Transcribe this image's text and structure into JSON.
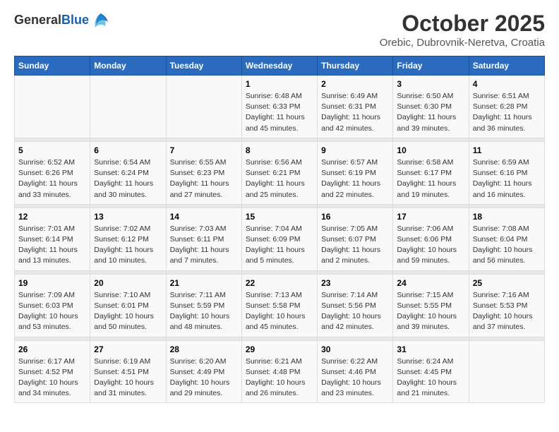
{
  "header": {
    "logo_general": "General",
    "logo_blue": "Blue",
    "title": "October 2025",
    "subtitle": "Orebic, Dubrovnik-Neretva, Croatia"
  },
  "days_of_week": [
    "Sunday",
    "Monday",
    "Tuesday",
    "Wednesday",
    "Thursday",
    "Friday",
    "Saturday"
  ],
  "weeks": [
    {
      "days": [
        {
          "num": "",
          "detail": ""
        },
        {
          "num": "",
          "detail": ""
        },
        {
          "num": "",
          "detail": ""
        },
        {
          "num": "1",
          "detail": "Sunrise: 6:48 AM\nSunset: 6:33 PM\nDaylight: 11 hours and 45 minutes."
        },
        {
          "num": "2",
          "detail": "Sunrise: 6:49 AM\nSunset: 6:31 PM\nDaylight: 11 hours and 42 minutes."
        },
        {
          "num": "3",
          "detail": "Sunrise: 6:50 AM\nSunset: 6:30 PM\nDaylight: 11 hours and 39 minutes."
        },
        {
          "num": "4",
          "detail": "Sunrise: 6:51 AM\nSunset: 6:28 PM\nDaylight: 11 hours and 36 minutes."
        }
      ]
    },
    {
      "days": [
        {
          "num": "5",
          "detail": "Sunrise: 6:52 AM\nSunset: 6:26 PM\nDaylight: 11 hours and 33 minutes."
        },
        {
          "num": "6",
          "detail": "Sunrise: 6:54 AM\nSunset: 6:24 PM\nDaylight: 11 hours and 30 minutes."
        },
        {
          "num": "7",
          "detail": "Sunrise: 6:55 AM\nSunset: 6:23 PM\nDaylight: 11 hours and 27 minutes."
        },
        {
          "num": "8",
          "detail": "Sunrise: 6:56 AM\nSunset: 6:21 PM\nDaylight: 11 hours and 25 minutes."
        },
        {
          "num": "9",
          "detail": "Sunrise: 6:57 AM\nSunset: 6:19 PM\nDaylight: 11 hours and 22 minutes."
        },
        {
          "num": "10",
          "detail": "Sunrise: 6:58 AM\nSunset: 6:17 PM\nDaylight: 11 hours and 19 minutes."
        },
        {
          "num": "11",
          "detail": "Sunrise: 6:59 AM\nSunset: 6:16 PM\nDaylight: 11 hours and 16 minutes."
        }
      ]
    },
    {
      "days": [
        {
          "num": "12",
          "detail": "Sunrise: 7:01 AM\nSunset: 6:14 PM\nDaylight: 11 hours and 13 minutes."
        },
        {
          "num": "13",
          "detail": "Sunrise: 7:02 AM\nSunset: 6:12 PM\nDaylight: 11 hours and 10 minutes."
        },
        {
          "num": "14",
          "detail": "Sunrise: 7:03 AM\nSunset: 6:11 PM\nDaylight: 11 hours and 7 minutes."
        },
        {
          "num": "15",
          "detail": "Sunrise: 7:04 AM\nSunset: 6:09 PM\nDaylight: 11 hours and 5 minutes."
        },
        {
          "num": "16",
          "detail": "Sunrise: 7:05 AM\nSunset: 6:07 PM\nDaylight: 11 hours and 2 minutes."
        },
        {
          "num": "17",
          "detail": "Sunrise: 7:06 AM\nSunset: 6:06 PM\nDaylight: 10 hours and 59 minutes."
        },
        {
          "num": "18",
          "detail": "Sunrise: 7:08 AM\nSunset: 6:04 PM\nDaylight: 10 hours and 56 minutes."
        }
      ]
    },
    {
      "days": [
        {
          "num": "19",
          "detail": "Sunrise: 7:09 AM\nSunset: 6:03 PM\nDaylight: 10 hours and 53 minutes."
        },
        {
          "num": "20",
          "detail": "Sunrise: 7:10 AM\nSunset: 6:01 PM\nDaylight: 10 hours and 50 minutes."
        },
        {
          "num": "21",
          "detail": "Sunrise: 7:11 AM\nSunset: 5:59 PM\nDaylight: 10 hours and 48 minutes."
        },
        {
          "num": "22",
          "detail": "Sunrise: 7:13 AM\nSunset: 5:58 PM\nDaylight: 10 hours and 45 minutes."
        },
        {
          "num": "23",
          "detail": "Sunrise: 7:14 AM\nSunset: 5:56 PM\nDaylight: 10 hours and 42 minutes."
        },
        {
          "num": "24",
          "detail": "Sunrise: 7:15 AM\nSunset: 5:55 PM\nDaylight: 10 hours and 39 minutes."
        },
        {
          "num": "25",
          "detail": "Sunrise: 7:16 AM\nSunset: 5:53 PM\nDaylight: 10 hours and 37 minutes."
        }
      ]
    },
    {
      "days": [
        {
          "num": "26",
          "detail": "Sunrise: 6:17 AM\nSunset: 4:52 PM\nDaylight: 10 hours and 34 minutes."
        },
        {
          "num": "27",
          "detail": "Sunrise: 6:19 AM\nSunset: 4:51 PM\nDaylight: 10 hours and 31 minutes."
        },
        {
          "num": "28",
          "detail": "Sunrise: 6:20 AM\nSunset: 4:49 PM\nDaylight: 10 hours and 29 minutes."
        },
        {
          "num": "29",
          "detail": "Sunrise: 6:21 AM\nSunset: 4:48 PM\nDaylight: 10 hours and 26 minutes."
        },
        {
          "num": "30",
          "detail": "Sunrise: 6:22 AM\nSunset: 4:46 PM\nDaylight: 10 hours and 23 minutes."
        },
        {
          "num": "31",
          "detail": "Sunrise: 6:24 AM\nSunset: 4:45 PM\nDaylight: 10 hours and 21 minutes."
        },
        {
          "num": "",
          "detail": ""
        }
      ]
    }
  ]
}
